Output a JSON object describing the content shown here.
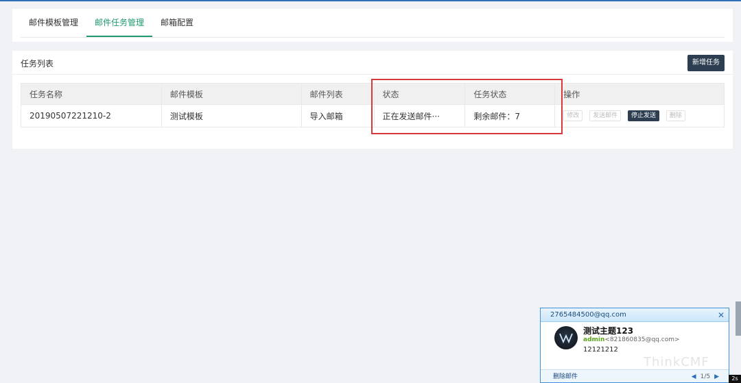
{
  "tabs": [
    {
      "label": "邮件模板管理"
    },
    {
      "label": "邮件任务管理"
    },
    {
      "label": "邮箱配置"
    }
  ],
  "active_tab": 1,
  "task_list": {
    "title": "任务列表",
    "add_button": "新增任务",
    "columns": [
      "任务名称",
      "邮件模板",
      "邮件列表",
      "状态",
      "任务状态",
      "操作"
    ],
    "rows": [
      {
        "name": "20190507221210-2",
        "template": "测试模板",
        "list": "导入邮箱",
        "status": "正在发送邮件···",
        "task_status": "剩余邮件：7",
        "actions": [
          "修改",
          "发送邮件",
          "停止发送",
          "删除"
        ]
      }
    ]
  },
  "notification": {
    "account": "2765484500@qq.com",
    "subject": "测试主题123",
    "sender_name": "admin",
    "sender_email": "<821860835@qq.com>",
    "preview": "12121212",
    "delete_label": "删除邮件",
    "pager": "1/5",
    "watermark": "ThinkCMF"
  },
  "corner_badge": "2s",
  "colors": {
    "accent": "#1e9a6c",
    "dark_button": "#2c3e50",
    "highlight": "#d9383a"
  }
}
